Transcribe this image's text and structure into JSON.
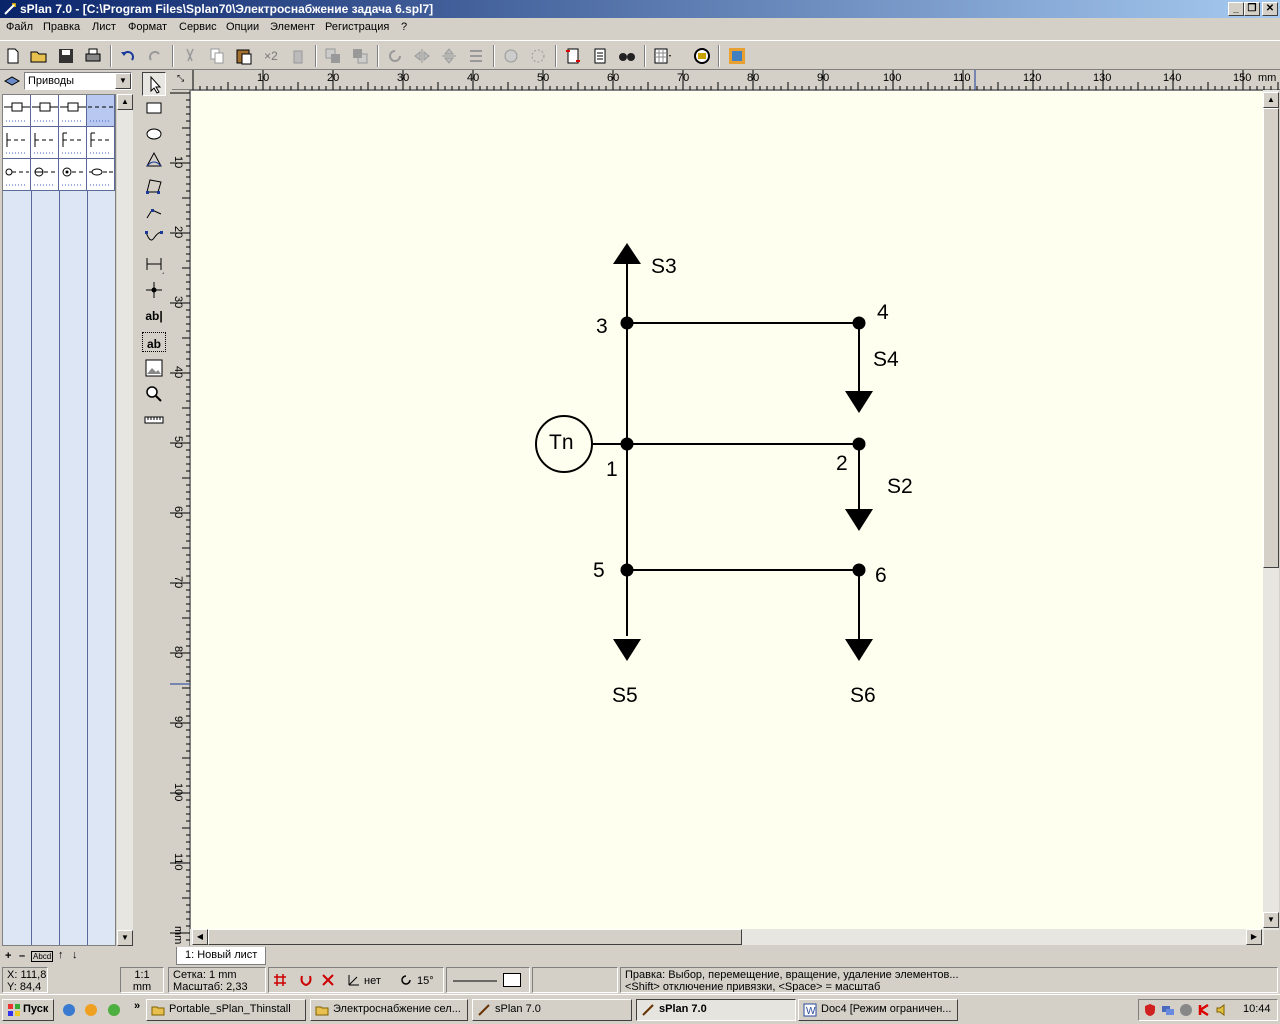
{
  "window": {
    "title": "sPlan 7.0 - [C:\\Program Files\\Splan70\\Электроснабжение задача 6.spl7]",
    "min_icon": "minimize-icon",
    "max_icon": "restore-icon",
    "close_icon": "close-icon"
  },
  "menu": {
    "items": [
      "Файл",
      "Правка",
      "Лист",
      "Формат",
      "Сервис",
      "Опции",
      "Элемент",
      "Регистрация",
      "?"
    ]
  },
  "toolbar": {
    "icons": [
      "new-file-icon",
      "open-folder-icon",
      "save-icon",
      "print-icon",
      "undo-icon",
      "redo-icon",
      "cut-icon",
      "copy-icon",
      "paste-icon",
      "duplicate-icon",
      "delete-icon",
      "to-front-icon",
      "to-back-icon",
      "rotate-icon",
      "mirror-horizontal-icon",
      "mirror-vertical-icon",
      "align-icon",
      "group-icon",
      "ungroup-icon",
      "snap-icon",
      "page-properties-icon",
      "find-icon",
      "grid-icon",
      "zoom-icon",
      "library-icon"
    ],
    "duplicate_label": "×2"
  },
  "library": {
    "selected": "Приводы",
    "bottom_controls": [
      "+",
      "–",
      "Abcd",
      "↑",
      "↓"
    ]
  },
  "tools": [
    "select-arrow-icon",
    "rectangle-icon",
    "ellipse-icon",
    "bezier-icon",
    "polygon-icon",
    "polyline-icon",
    "curve-icon",
    "dimension-icon",
    "junction-icon",
    "text-icon",
    "textbox-icon",
    "image-icon",
    "zoom-icon",
    "measure-icon"
  ],
  "tool_labels": {
    "text": "ab|",
    "textbox": "ab"
  },
  "ruler": {
    "horizontal": [
      "10",
      "20",
      "30",
      "40",
      "50",
      "60",
      "70",
      "80",
      "90",
      "100",
      "110",
      "120",
      "130",
      "140",
      "150"
    ],
    "h_unit": "mm",
    "vertical": [
      "10",
      "20",
      "30",
      "40",
      "50",
      "60",
      "70",
      "80",
      "90",
      "100",
      "110"
    ],
    "v_unit": "mm"
  },
  "diagram": {
    "source_label": "Tn",
    "node_labels": [
      "1",
      "2",
      "3",
      "4",
      "5",
      "6"
    ],
    "load_labels": [
      "S2",
      "S3",
      "S4",
      "S5",
      "S6"
    ]
  },
  "sheet": {
    "tab_label": "1: Новый лист"
  },
  "status": {
    "x": "X: 111,8",
    "y": "Y: 84,4",
    "scale1": "1:1",
    "unit": "mm",
    "grid": "Сетка: 1 mm",
    "zoom": "Масштаб:  2,33",
    "angle_snap": "нет",
    "rotate_angle": "15°",
    "hint1": "Правка: Выбор, перемещение, вращение, удаление элементов...",
    "hint2": "<Shift> отключение привязки, <Space> = масштаб"
  },
  "taskbar": {
    "start": "Пуск",
    "tasks": [
      "Portable_sPlan_Thinstall",
      "Электроснабжение сел...",
      "sPlan 7.0",
      "sPlan 7.0",
      "Doc4 [Режим ограничен..."
    ],
    "clock": "10:44"
  }
}
